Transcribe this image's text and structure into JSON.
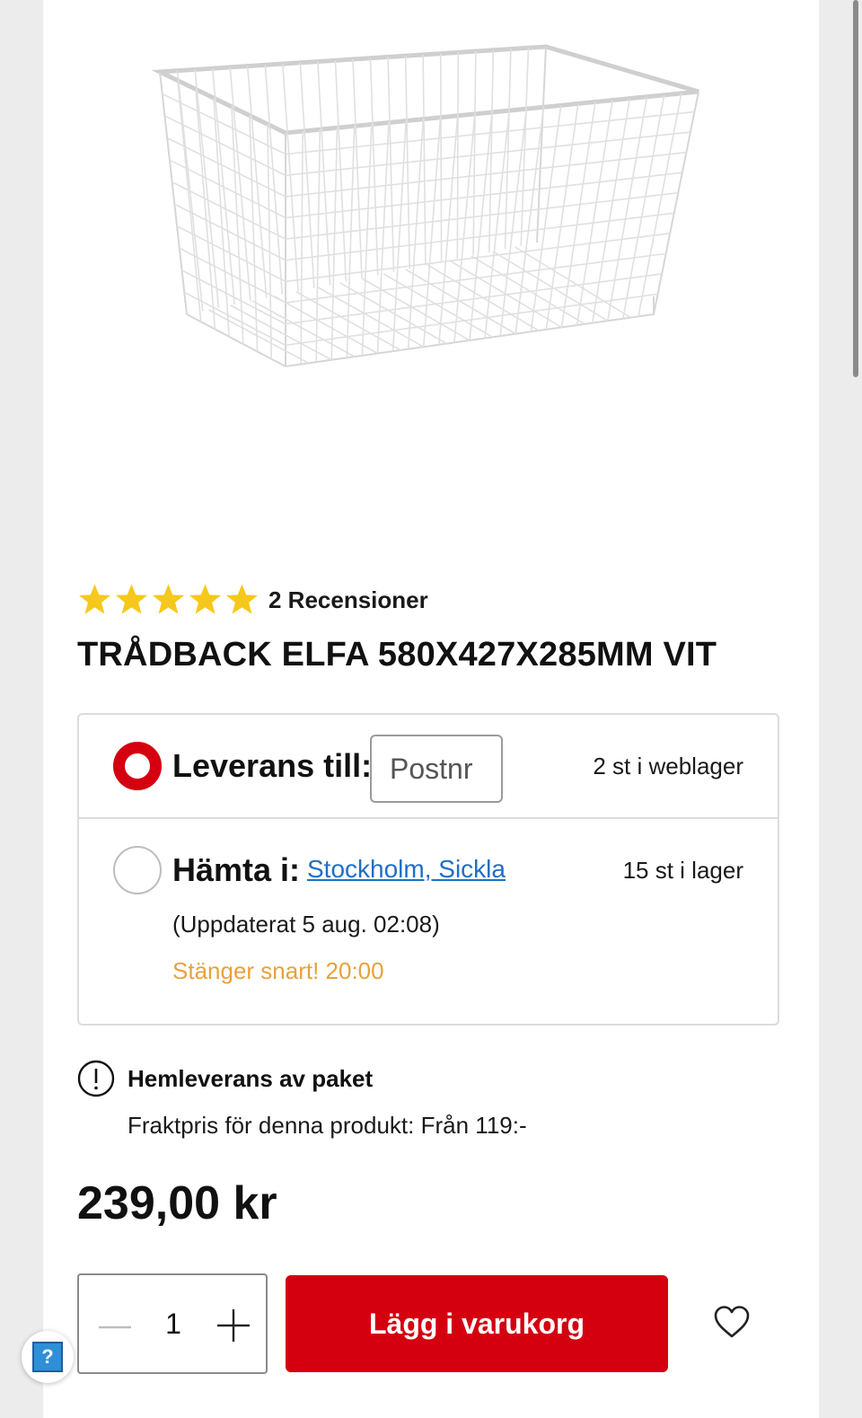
{
  "product": {
    "title": "TRÅDBACK ELFA 580X427X285MM VIT",
    "image_alt": "wire-basket",
    "rating": 5,
    "rating_max": 5,
    "review_count_label": "2 Recensioner",
    "price": "239,00 kr"
  },
  "delivery": {
    "label": "Leverans till:",
    "postnr_placeholder": "Postnr",
    "postnr_value": "",
    "stock": "2 st i weblager",
    "selected": true
  },
  "pickup": {
    "label": "Hämta i:",
    "store": "Stockholm, Sickla",
    "stock": "15 st i lager",
    "updated": "(Uppdaterat 5 aug. 02:08)",
    "closing": "Stänger snart! 20:00",
    "selected": false
  },
  "home_delivery": {
    "title": "Hemleverans av paket",
    "shipping": "Fraktpris för denna produkt: Från 119:-"
  },
  "cart": {
    "quantity": "1",
    "add_label": "Lägg i varukorg"
  },
  "help": {
    "label": "?"
  },
  "colors": {
    "accent": "#d40010",
    "link": "#1f6fc4",
    "warning": "#e6a23a",
    "star": "#f6c81c"
  },
  "icons": [
    "star-icon",
    "info-icon",
    "minus-icon",
    "plus-icon",
    "heart-icon",
    "help-icon"
  ]
}
